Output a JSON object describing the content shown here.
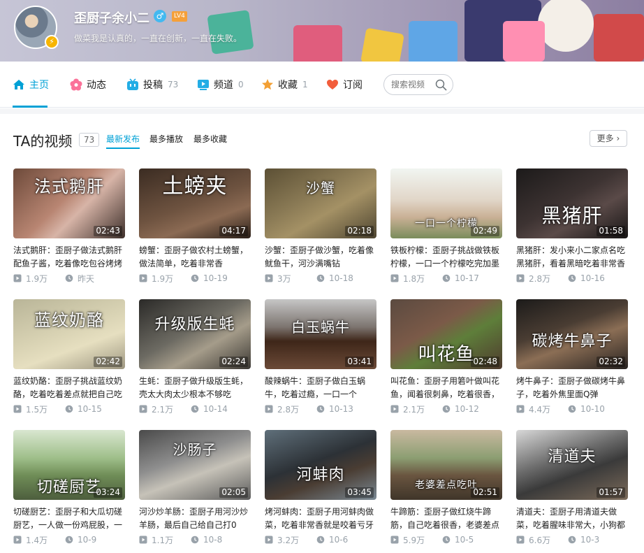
{
  "profile": {
    "name": "歪厨子余小二",
    "gender_symbol": "♂",
    "level": "LV4",
    "signature": "做菜我是认真的，一直在创新，一直在失败。"
  },
  "nav": {
    "items": [
      {
        "label": "主页",
        "count": "",
        "icon": "home-icon"
      },
      {
        "label": "动态",
        "count": "",
        "icon": "flower-icon"
      },
      {
        "label": "投稿",
        "count": "73",
        "icon": "tv-icon"
      },
      {
        "label": "频道",
        "count": "0",
        "icon": "channel-icon"
      },
      {
        "label": "收藏",
        "count": "1",
        "icon": "star-icon"
      },
      {
        "label": "订阅",
        "count": "",
        "icon": "heart-icon"
      }
    ],
    "search_placeholder": "搜索视频"
  },
  "section": {
    "title": "TA的视频",
    "count": "73",
    "sort_tabs": [
      "最新发布",
      "最多播放",
      "最多收藏"
    ],
    "more_label": "更多"
  },
  "videos": [
    {
      "overlay": "法式鹅肝",
      "duration": "02:43",
      "title": "法式鹅肝：歪厨子做法式鹅肝配鱼子酱，吃着像吃包谷烤烤",
      "views": "1.9万",
      "date": "昨天"
    },
    {
      "overlay": "土螃夹",
      "duration": "04:17",
      "title": "螃蟹：歪厨子做农村土螃蟹，做法简单，吃着非常香",
      "views": "1.9万",
      "date": "10-19"
    },
    {
      "overlay": "沙蟹",
      "duration": "02:18",
      "title": "沙蟹：歪厨子做沙蟹，吃着像鱿鱼干，河沙满嘴钻",
      "views": "3万",
      "date": "10-18"
    },
    {
      "overlay": "一口一个柠檬",
      "duration": "02:49",
      "title": "铁板柠檬：歪厨子挑战做铁板柠檬，一口一个柠檬吃完加墨",
      "views": "1.8万",
      "date": "10-17"
    },
    {
      "overlay": "黑猪肝",
      "duration": "01:58",
      "title": "黑猪肝：发小来小二家点名吃黑猪肝，看着黑暗吃着非常香",
      "views": "2.8万",
      "date": "10-16"
    },
    {
      "overlay": "蓝纹奶酪",
      "duration": "02:42",
      "title": "蓝纹奶酪：歪厨子挑战蓝纹奶酪，吃着吃着差点就把自己吃",
      "views": "1.5万",
      "date": "10-15"
    },
    {
      "overlay": "升级版生蚝",
      "duration": "02:24",
      "title": "生蚝：歪厨子做升级版生蚝，壳太大肉太少根本不够吃",
      "views": "2.1万",
      "date": "10-14"
    },
    {
      "overlay": "白玉蜗牛",
      "duration": "03:41",
      "title": "酸辣蜗牛：歪厨子做白玉蜗牛，吃着过瘾，一口一个",
      "views": "2.8万",
      "date": "10-13"
    },
    {
      "overlay": "叫花鱼",
      "duration": "02:48",
      "title": "叫花鱼：歪厨子用箬叶做叫花鱼，闻着很刺鼻，吃着很香，",
      "views": "2.1万",
      "date": "10-12"
    },
    {
      "overlay": "碳烤牛鼻子",
      "duration": "02:32",
      "title": "烤牛鼻子：歪厨子做碳烤牛鼻子，吃着外焦里面Q弹",
      "views": "4.4万",
      "date": "10-10"
    },
    {
      "overlay": "切磋厨艺",
      "duration": "03:24",
      "title": "切磋厨艺：歪厨子和大瓜切磋厨艺，一人做一份鸡屁股，一",
      "views": "1.4万",
      "date": "10-9"
    },
    {
      "overlay": "沙肠子",
      "duration": "02:05",
      "title": "河沙炒羊肠：歪厨子用河沙炒羊肠，最后自己给自己打0",
      "views": "1.1万",
      "date": "10-8"
    },
    {
      "overlay": "河蚌肉",
      "duration": "03:45",
      "title": "烤河蚌肉：歪厨子用河蚌肉做菜，吃着非常香就是咬着亏牙",
      "views": "3.2万",
      "date": "10-6"
    },
    {
      "overlay": "老婆差点吃吐",
      "duration": "02:51",
      "title": "牛蹄筋：歪厨子做红烧牛蹄筋，自己吃着很香，老婆差点",
      "views": "5.9万",
      "date": "10-5"
    },
    {
      "overlay": "清道夫",
      "duration": "01:57",
      "title": "清道夫：歪厨子用清道夫做菜，吃着腥味非常大，小狗都",
      "views": "6.6万",
      "date": "10-3"
    }
  ],
  "colors": {
    "accent": "#00a1d6",
    "muted": "#99a2aa",
    "border": "#ccd0d7"
  }
}
